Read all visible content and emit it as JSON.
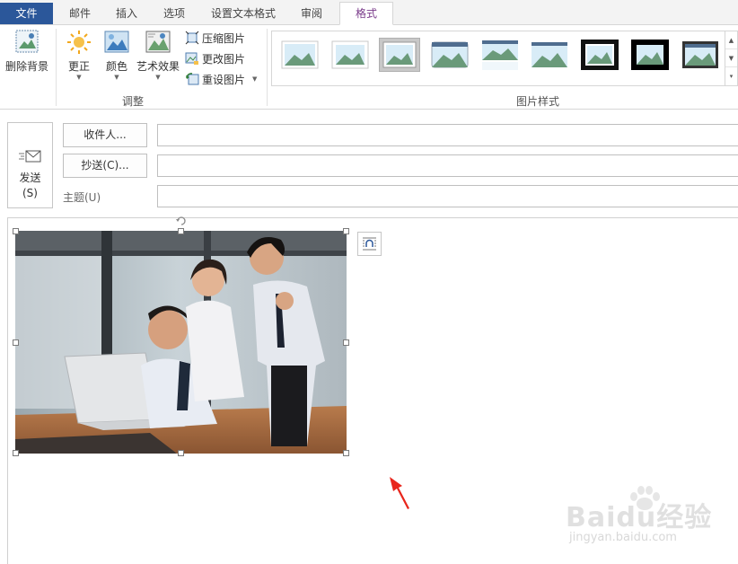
{
  "tabs": [
    {
      "label": "文件"
    },
    {
      "label": "邮件"
    },
    {
      "label": "插入"
    },
    {
      "label": "选项"
    },
    {
      "label": "设置文本格式"
    },
    {
      "label": "审阅"
    },
    {
      "label": "格式"
    }
  ],
  "ribbon": {
    "remove_background": "删除背景",
    "corrections": "更正",
    "color": "颜色",
    "artistic_effects": "艺术效果",
    "compress_pictures": "压缩图片",
    "change_picture": "更改图片",
    "reset_picture": "重设图片",
    "adjust_group_label": "调整",
    "picture_styles_group_label": "图片样式"
  },
  "compose": {
    "send_label_line1": "发送",
    "send_label_line2": "(S)",
    "to_button": "收件人...",
    "cc_button": "抄送(C)...",
    "subject_label": "主题(U)",
    "to_value": "",
    "cc_value": "",
    "subject_value": ""
  },
  "watermark": {
    "brand": "Baidu经验",
    "url": "jingyan.baidu.com"
  },
  "colors": {
    "file_tab": "#2b579a",
    "active_tab_text": "#7a3b8a",
    "annotation_arrow": "#e8261c"
  }
}
